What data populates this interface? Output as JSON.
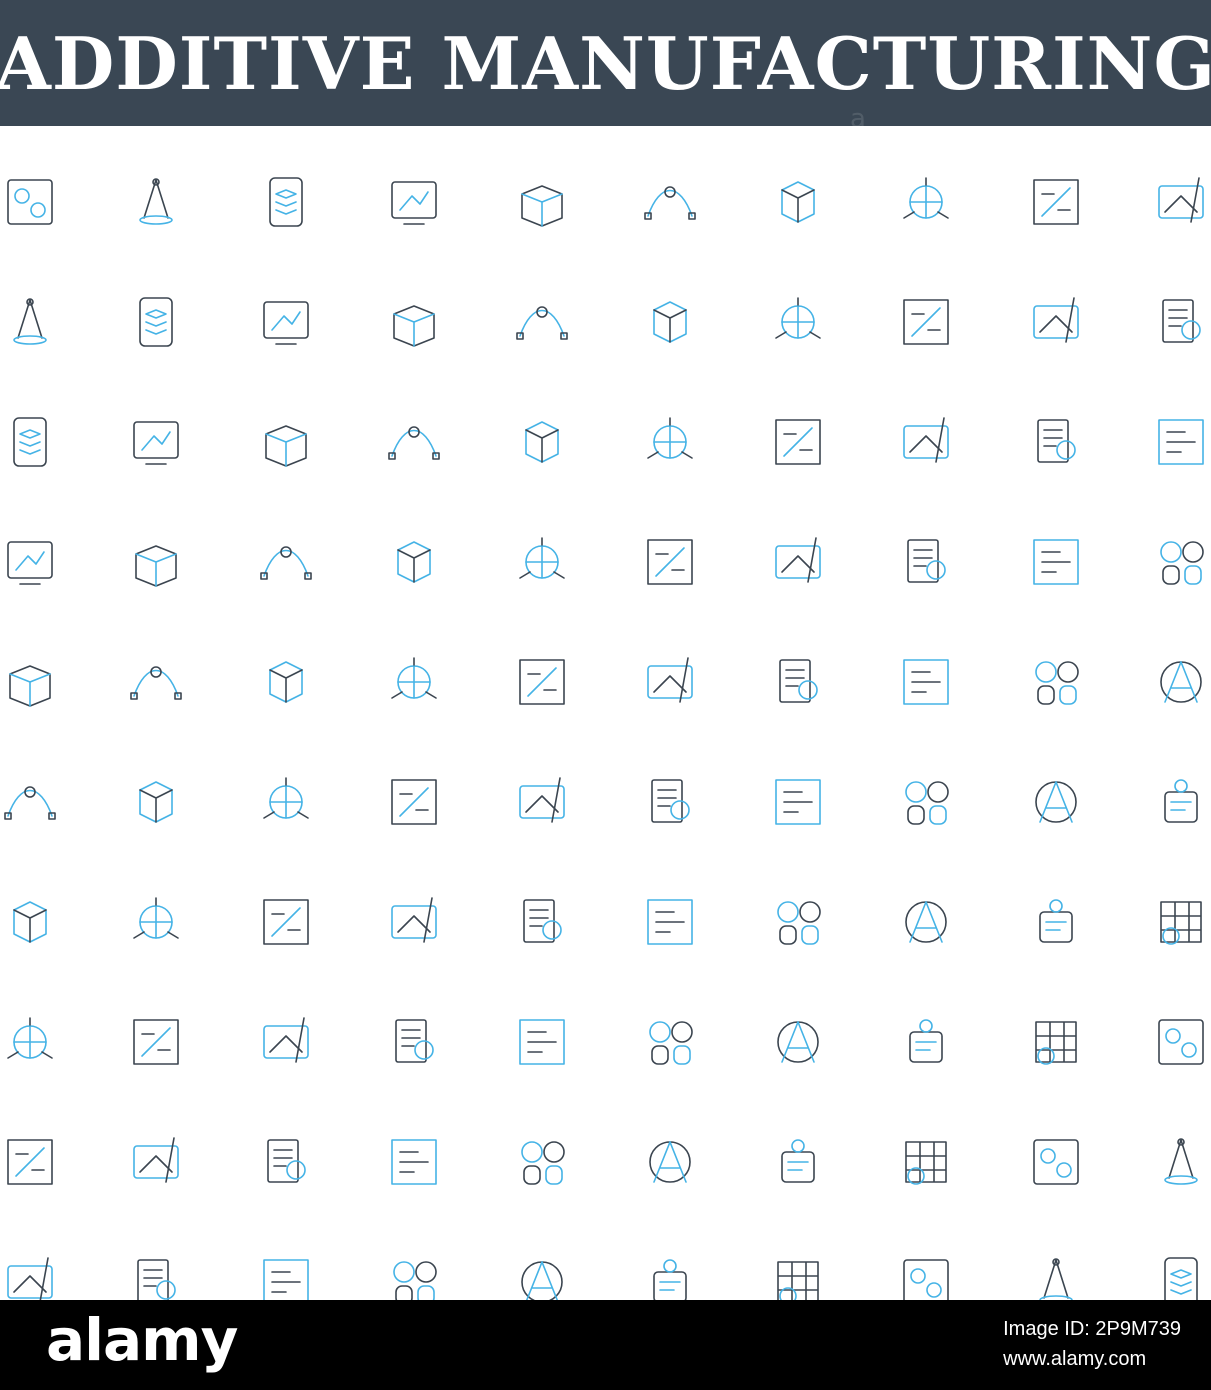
{
  "title": "ADDITIVE MANUFACTURING",
  "footer": {
    "logo": "alamy",
    "image_id_label": "Image ID: 2P9M739",
    "site": "www.alamy.com"
  },
  "colors": {
    "title_bg": "#3a4754",
    "icon_blue": "#45b3e6",
    "icon_dark": "#3b4550",
    "footer_bg": "#000000"
  },
  "icons": [
    "blueprint-icon",
    "globe-arrows-icon",
    "idea-ladder-icon",
    "bezier-path-icon",
    "shapes-icon",
    "tablet-design-icon",
    "document-search-icon",
    "compass-drawing-icon",
    "blueprint-ruler-icon",
    "grid-pencil-icon",
    "hexagon-boxes-icon",
    "perspective-road-icon",
    "open-box-icon",
    "floor-plan-icon",
    "phone-layers-icon",
    "design-tools-icon",
    "document-files-icon",
    "image-gallery-icon",
    "resize-frame-icon",
    "disc-rotate-icon",
    "laptop-process-icon",
    "drone-controller-icon",
    "robot-arms-icon",
    "engineer-worker-icon",
    "monitor-tools-icon",
    "robotic-arm-icon",
    "factory-robot-icon",
    "robot-assistant-icon",
    "robot-screen-icon",
    "monitor-chart-icon",
    "robot-gears-icon",
    "cnc-machine-icon",
    "code-window-icon",
    "robot-vacuum-icon",
    "industrial-robot-icon",
    "robotic-press-icon",
    "humanoid-face-icon",
    "target-data-icon",
    "hover-drone-icon",
    "robot-gripper-icon",
    "tower-signal-icon",
    "vr-user-icon",
    "robot-body-icon",
    "circuit-board-icon",
    "ai-robot-icon",
    "robot-network-icon",
    "robot-laptop-icon",
    "robot-speakers-icon",
    "robot-document-icon",
    "remote-control-icon",
    "robot-bolt-icon",
    "laptop-robot-icon",
    "robot-vehicle-icon",
    "microchip-icon",
    "manual-book-icon",
    "female-engineer-icon",
    "robot-claw-icon",
    "cloud-idea-icon",
    "gear-bulb-icon",
    "robotic-arm-factory-icon",
    "hand-sensor-icon",
    "vr-camera-icon",
    "robot-arm-small-icon",
    "conveyor-icon",
    "autonomous-car-icon",
    "chip-gear-icon",
    "gear-network-icon",
    "android-head-icon",
    "tow-truck-icon",
    "quadcopter-icon",
    "robot-head-icon",
    "globe-pin-icon",
    "head-phone-icon",
    "robot-figure-icon",
    "bullet-train-icon",
    "hands-gear-icon",
    "snake-robot-icon",
    "ai-head-icon",
    "tablet-touch-icon",
    "tablet-stars-icon",
    "usb-wifi-icon",
    "globe-gamepad-icon",
    "round-dashboard-icon",
    "keyboard-icon",
    "glove-sensor-icon",
    "video-360-icon",
    "tablet-vr-icon",
    "vr-laptop-icon",
    "vr-controller-icon",
    "vr-dome-icon",
    "vr-headset-person-icon",
    "vr-headphones-icon",
    "gamepad-icon",
    "vr-player-icon",
    "vr-controllers-icon",
    "vr-monitor-icon",
    "phone-vr-icon",
    "glove-pixels-icon",
    "webcam-360-icon",
    "video-360-band-icon"
  ]
}
